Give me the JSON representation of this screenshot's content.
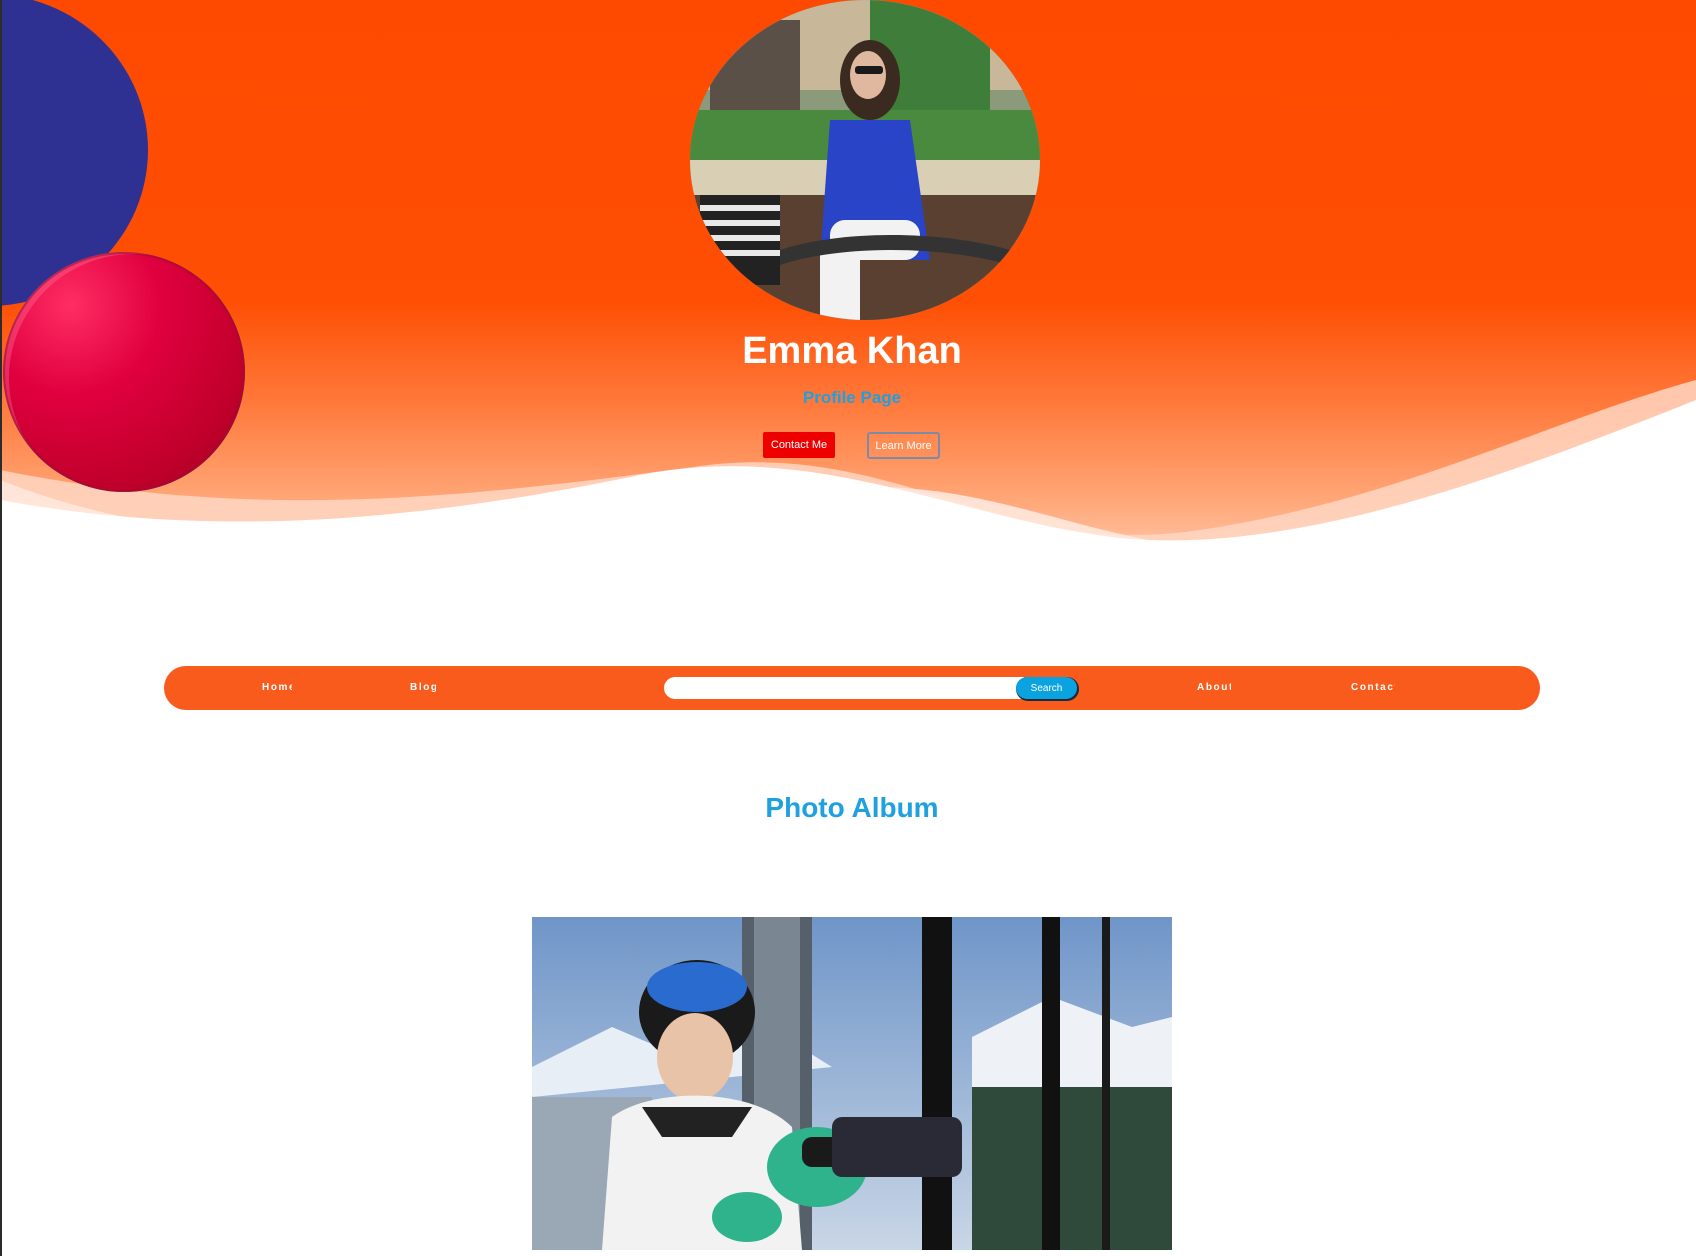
{
  "profile": {
    "name": "Emma Khan",
    "subtitle": "Profile Page",
    "contact_label": "Contact Me",
    "learn_label": "Learn More"
  },
  "nav": {
    "home": "Home",
    "blog": "Blog",
    "about": "About",
    "contact": "Contact",
    "search_placeholder": "",
    "search_label": "Search"
  },
  "album": {
    "title": "Photo Album"
  },
  "colors": {
    "hero_orange": "#fe4a00",
    "navbar": "#f95b1d",
    "accent_blue": "#1fa0df",
    "contact_red": "#ee0000",
    "circle_blue": "#2e3192",
    "circle_red": "#d0003a"
  }
}
